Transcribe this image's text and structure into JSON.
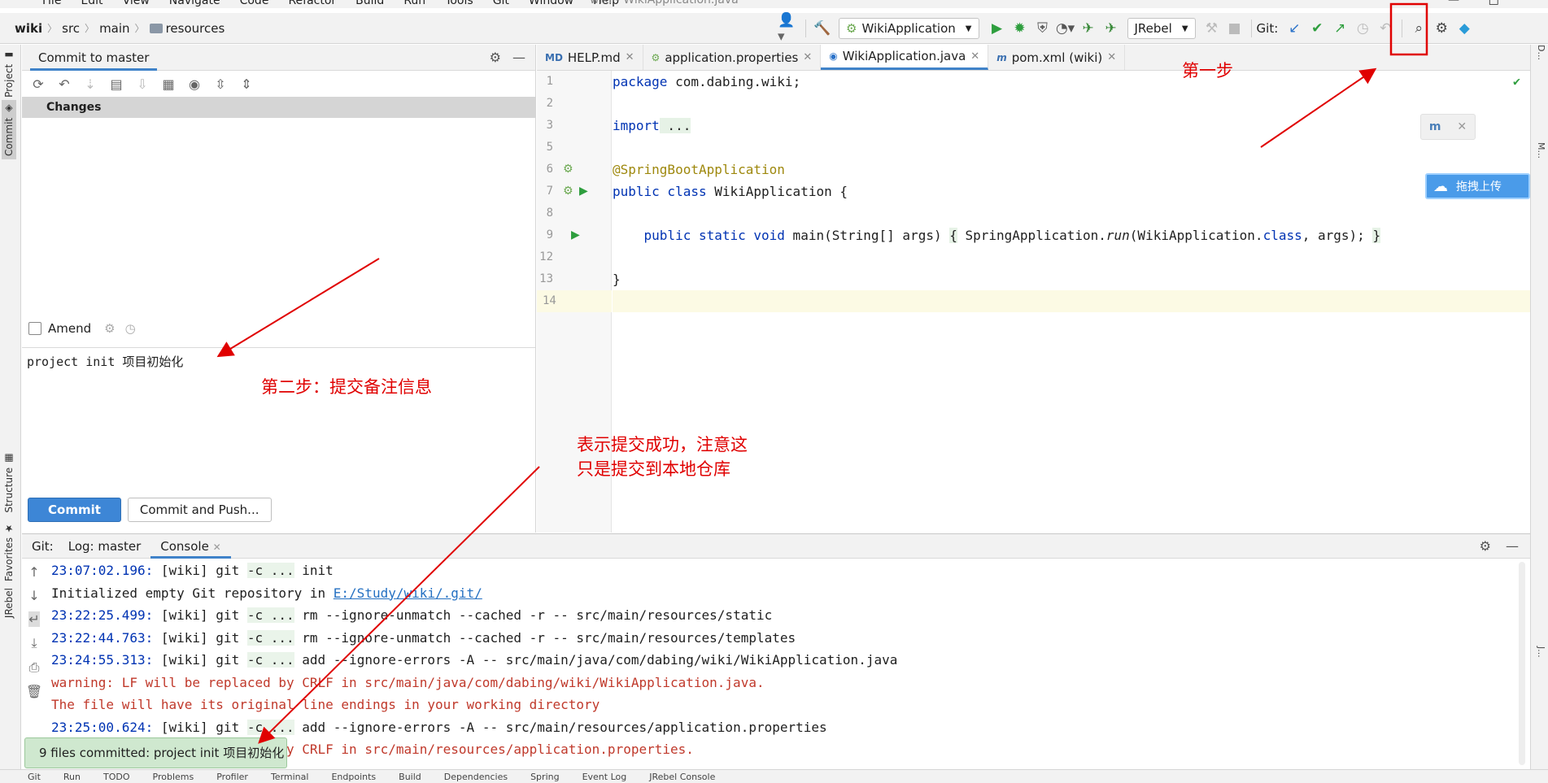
{
  "menu": {
    "items": [
      "File",
      "Edit",
      "View",
      "Navigate",
      "Code",
      "Refactor",
      "Build",
      "Run",
      "Tools",
      "Git",
      "Window",
      "Help"
    ],
    "window_title": "wiki - WikiApplication.java"
  },
  "breadcrumb": [
    "wiki",
    "src",
    "main",
    "resources"
  ],
  "toolbar": {
    "run_config": "WikiApplication",
    "jrebel": "JRebel",
    "git_label": "Git:"
  },
  "left_stripe": {
    "project": "Project",
    "commit": "Commit",
    "structure": "Structure",
    "favorites": "Favorites",
    "jrebel": "JRebel"
  },
  "commit_panel": {
    "title": "Commit to master",
    "changes_header": "Changes",
    "amend_label": "Amend",
    "message": "project init 项目初始化",
    "commit_button": "Commit",
    "commit_push_button": "Commit and Push..."
  },
  "editor": {
    "tabs": [
      {
        "label": "HELP.md",
        "icon": "markdown-icon"
      },
      {
        "label": "application.properties",
        "icon": "properties-icon"
      },
      {
        "label": "WikiApplication.java",
        "icon": "java-class-icon",
        "active": true
      },
      {
        "label": "pom.xml (wiki)",
        "icon": "maven-icon"
      }
    ],
    "line_numbers": [
      "1",
      "2",
      "3",
      "5",
      "6",
      "7",
      "8",
      "9",
      "12",
      "13",
      "14"
    ],
    "code": {
      "l1_kw": "package",
      "l1_rest": " com.dabing.wiki;",
      "l3_kw": "import",
      "l3_rest": " ...",
      "l6": "@SpringBootApplication",
      "l7_kw": "public class",
      "l7_rest": " WikiApplication {",
      "l9_indent": "    ",
      "l9_kw": "public static void",
      "l9_main": " main",
      "l9_args": "(String[] args) ",
      "l9_brace": "{",
      "l9_sa": " SpringApplication.",
      "l9_run": "run",
      "l9_call": "(WikiApplication.",
      "l9_class": "class",
      "l9_tail": ", args); ",
      "l9_close": "}",
      "l13": "}"
    }
  },
  "floating": {
    "upload_label": "拖拽上传"
  },
  "bottom_panel": {
    "tabs": [
      "Git:",
      "Log: master",
      "Console"
    ],
    "console_lines": [
      {
        "ts": "23:07:02.196:",
        "rest": " [wiki] git ",
        "flag": "-c ...",
        "cmd": " init",
        "type": "cmd"
      },
      {
        "text": "Initialized empty Git repository in ",
        "link": "E:/Study/wiki/.git/",
        "type": "info"
      },
      {
        "ts": "23:22:25.499:",
        "rest": " [wiki] git ",
        "flag": "-c ...",
        "cmd": " rm --ignore-unmatch --cached -r -- src/main/resources/static",
        "type": "cmd"
      },
      {
        "ts": "23:22:44.763:",
        "rest": " [wiki] git ",
        "flag": "-c ...",
        "cmd": " rm --ignore-unmatch --cached -r -- src/main/resources/templates",
        "type": "cmd"
      },
      {
        "ts": "23:24:55.313:",
        "rest": " [wiki] git ",
        "flag": "-c ...",
        "cmd": " add --ignore-errors -A -- src/main/java/com/dabing/wiki/WikiApplication.java",
        "type": "cmd"
      },
      {
        "text": "warning: LF will be replaced by CRLF in src/main/java/com/dabing/wiki/WikiApplication.java.",
        "type": "warn"
      },
      {
        "text": "The file will have its original line endings in your working directory",
        "type": "warn"
      },
      {
        "ts": "23:25:00.624:",
        "rest": " [wiki] git ",
        "flag": "-c ...",
        "cmd": " add --ignore-errors -A -- src/main/resources/application.properties",
        "type": "cmd"
      },
      {
        "text": "warning: LF will be replaced by CRLF in src/main/resources/application.properties.",
        "type": "warn"
      }
    ]
  },
  "notification": "9 files committed: project init 项目初始化",
  "statusbar": [
    "Git",
    "Run",
    "TODO",
    "Problems",
    "Profiler",
    "Terminal",
    "Endpoints",
    "Build",
    "Dependencies",
    "Spring",
    "Event Log",
    "JRebel Console"
  ],
  "annotations": {
    "step1": "第一步",
    "step2": "第二步：提交备注信息",
    "note_line1": "表示提交成功，注意这",
    "note_line2": "只是提交到本地仓库"
  },
  "colors": {
    "annotation": "#e00000",
    "accent": "#4083c9",
    "commit_button": "#3d86d6",
    "balloon": "#cfe8cf"
  }
}
